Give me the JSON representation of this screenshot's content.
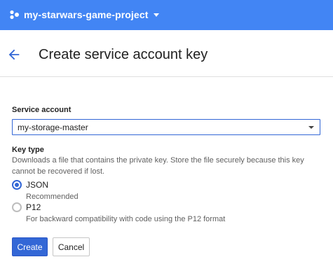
{
  "topbar": {
    "project_name": "my-starwars-game-project",
    "bg_color": "#4285f4"
  },
  "header": {
    "title": "Create service account key",
    "back_icon": "arrow-left-icon"
  },
  "form": {
    "service_account": {
      "label": "Service account",
      "value": "my-storage-master"
    },
    "key_type": {
      "label": "Key type",
      "help": "Downloads a file that contains the private key. Store the file securely because this key cannot be recovered if lost.",
      "options": [
        {
          "label": "JSON",
          "description": "Recommended",
          "selected": true
        },
        {
          "label": "P12",
          "description": "For backward compatibility with code using the P12 format",
          "selected": false
        }
      ]
    }
  },
  "actions": {
    "create_label": "Create",
    "cancel_label": "Cancel"
  },
  "colors": {
    "accent": "#3367d6"
  }
}
